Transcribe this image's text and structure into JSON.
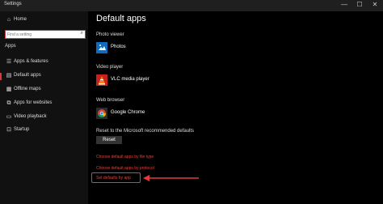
{
  "window": {
    "title": "Settings",
    "minimize": "—",
    "maximize": "☐",
    "close": "✕"
  },
  "sidebar": {
    "home": "Home",
    "search_placeholder": "Find a setting",
    "section": "Apps",
    "items": [
      {
        "label": "Apps & features",
        "icon": "☰"
      },
      {
        "label": "Default apps",
        "icon": "▤",
        "active": true
      },
      {
        "label": "Offline maps",
        "icon": "▦"
      },
      {
        "label": "Apps for websites",
        "icon": "⧉"
      },
      {
        "label": "Video playback",
        "icon": "▭"
      },
      {
        "label": "Startup",
        "icon": "⊡"
      }
    ]
  },
  "main": {
    "heading": "Default apps",
    "photo_viewer": {
      "label": "Photo viewer",
      "app": "Photos"
    },
    "video_player": {
      "label": "Video player",
      "app": "VLC media player"
    },
    "web_browser": {
      "label": "Web browser",
      "app": "Google Chrome"
    },
    "reset": {
      "label": "Reset to the Microsoft recommended defaults",
      "button": "Reset"
    },
    "links": {
      "by_file_type": "Choose default apps by file type",
      "by_protocol": "Choose default apps by protocol",
      "by_app": "Set defaults by app"
    }
  },
  "colors": {
    "accent": "#d63b3b",
    "link": "#e0443c"
  }
}
